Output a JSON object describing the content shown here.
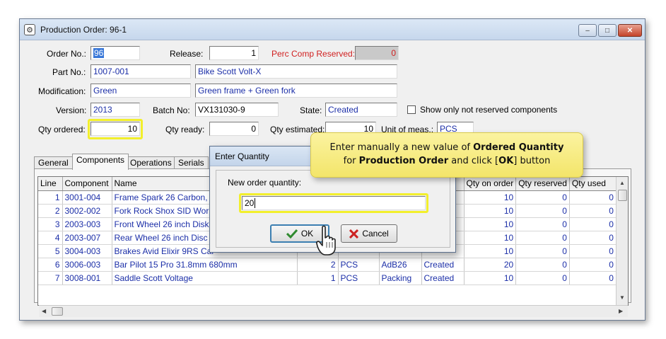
{
  "window": {
    "title": "Production Order: 96-1",
    "controls": [
      "minimize",
      "maximize",
      "close"
    ]
  },
  "header": {
    "order_no_label": "Order No.:",
    "order_no_value": "96",
    "release_label": "Release:",
    "release_value": "1",
    "perc_comp_label": "Perc Comp Reserved:",
    "perc_comp_value": "0",
    "part_no_label": "Part No.:",
    "part_no_value": "1007-001",
    "part_desc": "Bike Scott Volt-X",
    "modification_label": "Modification:",
    "modification_value": "Green",
    "modification_desc": "Green frame + Green fork",
    "version_label": "Version:",
    "version_value": "2013",
    "batch_no_label": "Batch No:",
    "batch_no_value": "VX131030-9",
    "state_label": "State:",
    "state_value": "Created",
    "show_not_reserved_label": "Show only not reserved components",
    "qty_ordered_label": "Qty ordered:",
    "qty_ordered_value": "10",
    "qty_ready_label": "Qty ready:",
    "qty_ready_value": "0",
    "qty_estimated_label": "Qty estimated:",
    "qty_estimated_value": "10",
    "unit_label": "Unit of meas.:",
    "unit_value": "PCS"
  },
  "tabs": [
    "General",
    "Components",
    "Operations",
    "Serials"
  ],
  "active_tab": "Components",
  "grid": {
    "columns": [
      "Line",
      "Component",
      "Name",
      "",
      "",
      "",
      "",
      "Qty on order",
      "Qty reserved",
      "Qty used"
    ],
    "rows": [
      {
        "line": "1",
        "component": "3001-004",
        "name": "Frame Spark 26 Carbon, M",
        "qty": "",
        "unit": "",
        "loc": "",
        "state": "",
        "on_order": "10",
        "reserved": "0",
        "used": "0"
      },
      {
        "line": "2",
        "component": "3002-002",
        "name": "Fork Rock Shox SID Worl",
        "qty": "",
        "unit": "",
        "loc": "",
        "state": "",
        "on_order": "10",
        "reserved": "0",
        "used": "0"
      },
      {
        "line": "3",
        "component": "2003-003",
        "name": "Front Wheel 26 inch Disk",
        "qty": "",
        "unit": "",
        "loc": "",
        "state": "",
        "on_order": "10",
        "reserved": "0",
        "used": "0"
      },
      {
        "line": "4",
        "component": "2003-007",
        "name": "Rear Wheel 26 inch Disc",
        "qty": "",
        "unit": "",
        "loc": "",
        "state": "",
        "on_order": "10",
        "reserved": "0",
        "used": "0"
      },
      {
        "line": "5",
        "component": "3004-003",
        "name": "Brakes Avid Elixir 9RS Car",
        "qty": "",
        "unit": "",
        "loc": "",
        "state": "",
        "on_order": "10",
        "reserved": "0",
        "used": "0"
      },
      {
        "line": "6",
        "component": "3006-003",
        "name": "Bar Pilot 15 Pro 31.8mm 680mm",
        "qty": "2",
        "unit": "PCS",
        "loc": "AdB26",
        "state": "Created",
        "on_order": "20",
        "reserved": "0",
        "used": "0"
      },
      {
        "line": "7",
        "component": "3008-001",
        "name": "Saddle Scott Voltage",
        "qty": "1",
        "unit": "PCS",
        "loc": "Packing",
        "state": "Created",
        "on_order": "10",
        "reserved": "0",
        "used": "0"
      }
    ]
  },
  "dialog": {
    "title": "Enter Quantity",
    "prompt": "New order quantity:",
    "value": "20",
    "ok_label": "OK",
    "cancel_label": "Cancel"
  },
  "callout": {
    "line1_pre": "Enter manually a new value of ",
    "line1_bold": "Ordered Quantity",
    "line2_pre": "for ",
    "line2_bold": "Production Order",
    "line2_mid": " and click [",
    "line2_bold2": "OK",
    "line2_post": "] button"
  },
  "colors": {
    "field_text": "#1c2fa8",
    "highlight": "#f2ef2c",
    "callout_bg": "#f3e56a",
    "warning_text": "#d02020"
  },
  "icons": [
    "app-gear-icon",
    "checkmark-icon",
    "cross-icon",
    "hand-cursor-icon"
  ]
}
